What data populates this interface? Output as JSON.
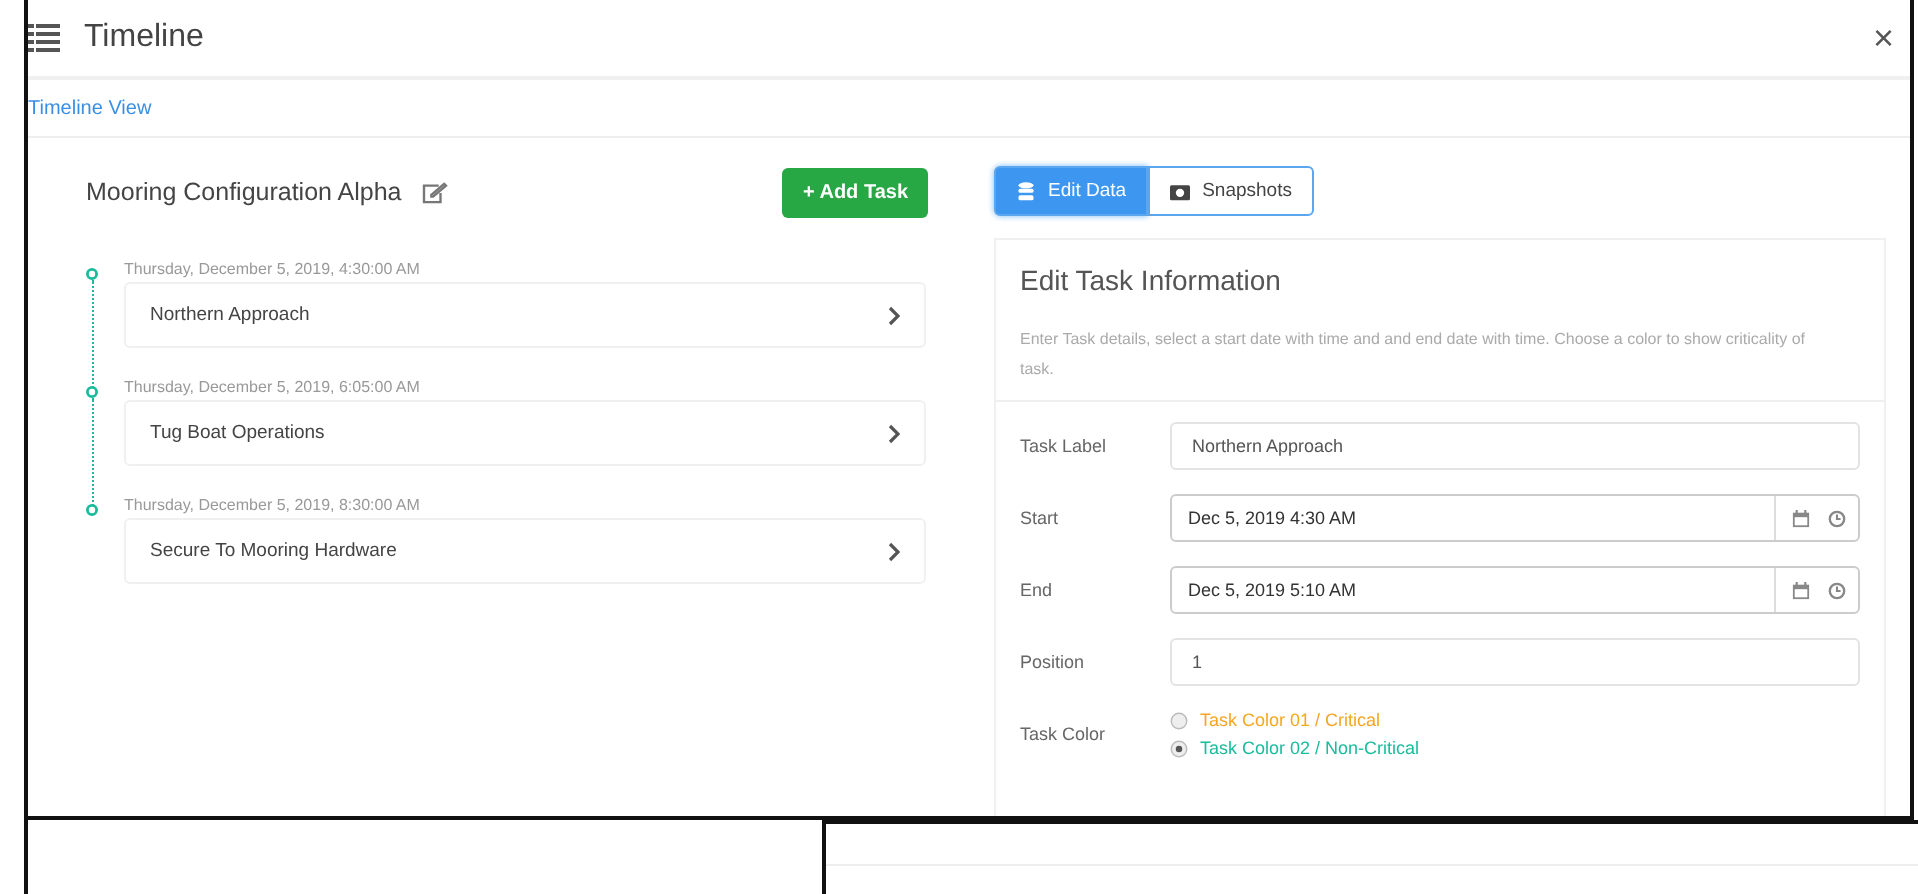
{
  "window": {
    "title": "Timeline",
    "close": "×"
  },
  "breadcrumb": "Timeline View",
  "timeline": {
    "title": "Mooring Configuration Alpha",
    "add_button": "+ Add Task",
    "items": [
      {
        "date": "Thursday, December 5, 2019, 4:30:00 AM",
        "label": "Northern Approach"
      },
      {
        "date": "Thursday, December 5, 2019, 6:05:00 AM",
        "label": "Tug Boat Operations"
      },
      {
        "date": "Thursday, December 5, 2019, 8:30:00 AM",
        "label": "Secure To Mooring Hardware"
      }
    ]
  },
  "tabs": [
    {
      "label": "Edit Data",
      "selected": true
    },
    {
      "label": "Snapshots",
      "selected": false
    }
  ],
  "form": {
    "title": "Edit Task Information",
    "description": "Enter Task details, select a start date with time and and end date with time. Choose a color to show criticality of task.",
    "fields": [
      {
        "kind": "text",
        "label": "Task Label",
        "value": "Northern Approach"
      },
      {
        "kind": "datetime",
        "label": "Start",
        "value": "Dec 5, 2019 4:30 AM"
      },
      {
        "kind": "datetime",
        "label": "End",
        "value": "Dec 5, 2019 5:10 AM"
      },
      {
        "kind": "text",
        "label": "Position",
        "value": "1"
      },
      {
        "kind": "radio",
        "label": "Task Color",
        "options": [
          {
            "label": "Task Color 01 / Critical",
            "color": "#f5a623",
            "selected": false
          },
          {
            "label": "Task Color 02 / Non-Critical",
            "color": "#1abc9c",
            "selected": true
          }
        ]
      }
    ]
  }
}
